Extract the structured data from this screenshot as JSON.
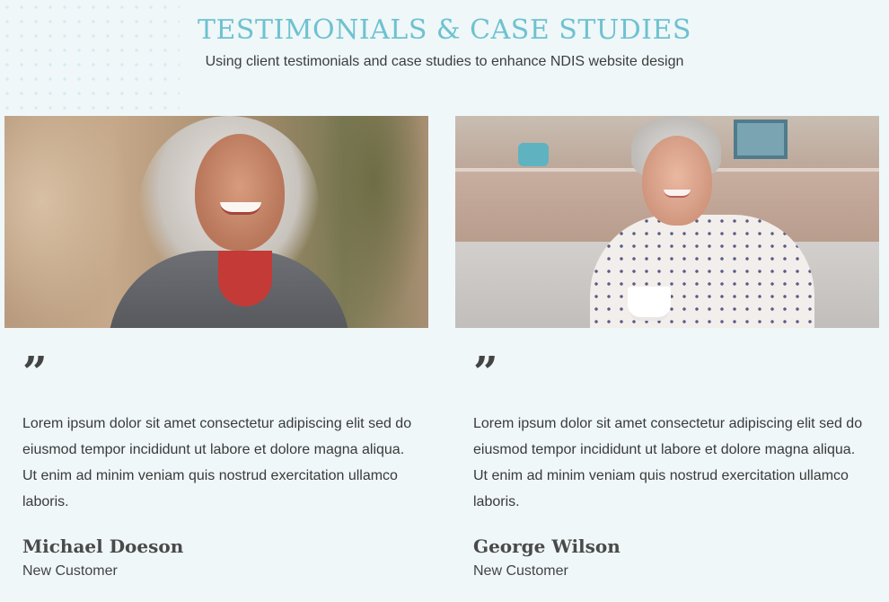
{
  "section": {
    "title": "TESTIMONIALS & CASE STUDIES",
    "subtitle": "Using client testimonials and case studies to enhance NDIS website design"
  },
  "testimonials": [
    {
      "quote_icon": "quote-icon",
      "quote_mark": "”",
      "text": "Lorem ipsum dolor sit amet consectetur adipiscing elit sed do eiusmod tempor incididunt ut labore et dolore magna aliqua. Ut enim ad minim veniam quis nostrud exercitation ullamco laboris.",
      "name": "Michael Doeson",
      "role": "New Customer"
    },
    {
      "quote_icon": "quote-icon",
      "quote_mark": "”",
      "text": "Lorem ipsum dolor sit amet consectetur adipiscing elit sed do eiusmod tempor incididunt ut labore et dolore magna aliqua. Ut enim ad minim veniam quis nostrud exercitation ullamco laboris.",
      "name": "George Wilson",
      "role": "New Customer"
    }
  ],
  "colors": {
    "title": "#6ec2cf",
    "background": "#eff7f9",
    "text": "#3a3a3a"
  }
}
